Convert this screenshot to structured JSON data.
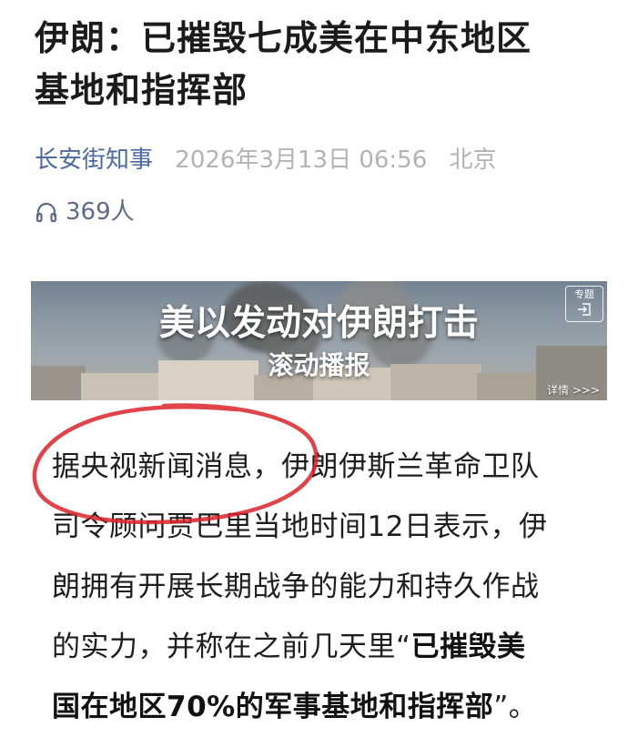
{
  "article": {
    "title_lines": [
      "伊朗：已摧毁七成美在中东地区",
      "基地和指挥部"
    ],
    "source": "长安街知事",
    "datetime": "2026年3月13日 06:56",
    "location": "北京",
    "listen_count": "369人"
  },
  "banner": {
    "title": "美以发动对伊朗打击",
    "subtitle": "滚动播报",
    "topic_badge": "专题",
    "detail_link": "详情 >>>"
  },
  "body": {
    "line1": "据央视新闻消息，伊朗伊斯兰革命卫队",
    "line2": "司令顾问贾巴里当地时间12日表示，伊",
    "line3": "朗拥有开展长期战争的能力和持久作战",
    "line4_normal": "的实力，并称在之前几天里“",
    "line4_bold": "已摧毁美",
    "line5_bold": "国在地区70%的军事基地和指挥部",
    "line5_tail": "”。"
  },
  "colors": {
    "source": "#4a6aa0",
    "meta_gray": "#b3b3b3",
    "annotation_red": "#d8232a"
  },
  "icons": {
    "listen": "headphones-icon",
    "topic_enter": "enter-icon"
  }
}
